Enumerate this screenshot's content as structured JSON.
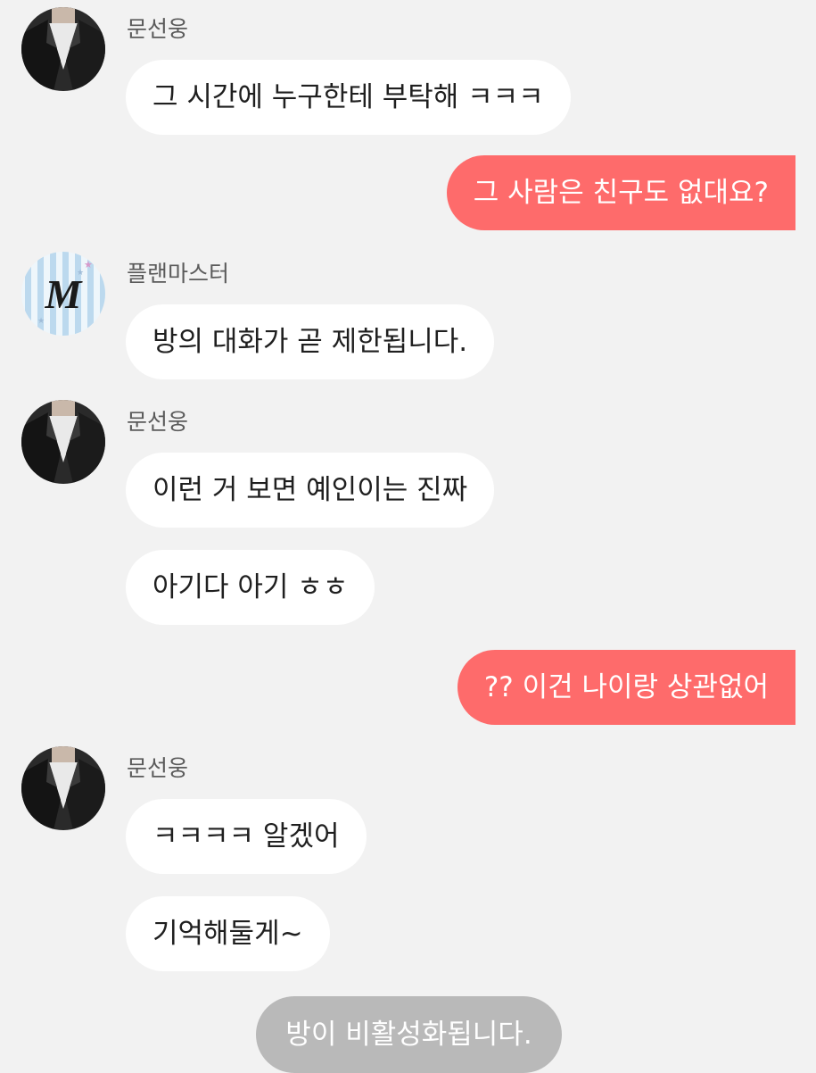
{
  "messages": [
    {
      "sender": "문선웅",
      "text": "그 시간에 누구한테 부탁해 ㅋㅋㅋ",
      "avatar_icon": "leather-jacket-photo-avatar"
    },
    {
      "sender": "me",
      "text": "그 사람은 친구도 없대요?"
    },
    {
      "sender": "플랜마스터",
      "text": "방의 대화가 곧 제한됩니다.",
      "avatar_icon": "letter-m-striped-avatar"
    },
    {
      "sender": "문선웅",
      "text": "이런 거 보면 예인이는 진짜",
      "avatar_icon": "leather-jacket-photo-avatar"
    },
    {
      "sender": "문선웅",
      "text": "아기다 아기 ㅎㅎ"
    },
    {
      "sender": "me",
      "text": "?? 이건 나이랑 상관없어"
    },
    {
      "sender": "문선웅",
      "text": "ㅋㅋㅋㅋ 알겠어",
      "avatar_icon": "leather-jacket-photo-avatar"
    },
    {
      "sender": "문선웅",
      "text": "기억해둘게~"
    }
  ],
  "system_notice": "방이 비활성화됩니다.",
  "avatar_m_letter": "M",
  "colors": {
    "background": "#f2f2f2",
    "incoming_bubble": "#ffffff",
    "outgoing_bubble": "#fe6b6b",
    "system_bubble": "#b9b9b9",
    "name_text": "#5a5a5a"
  }
}
